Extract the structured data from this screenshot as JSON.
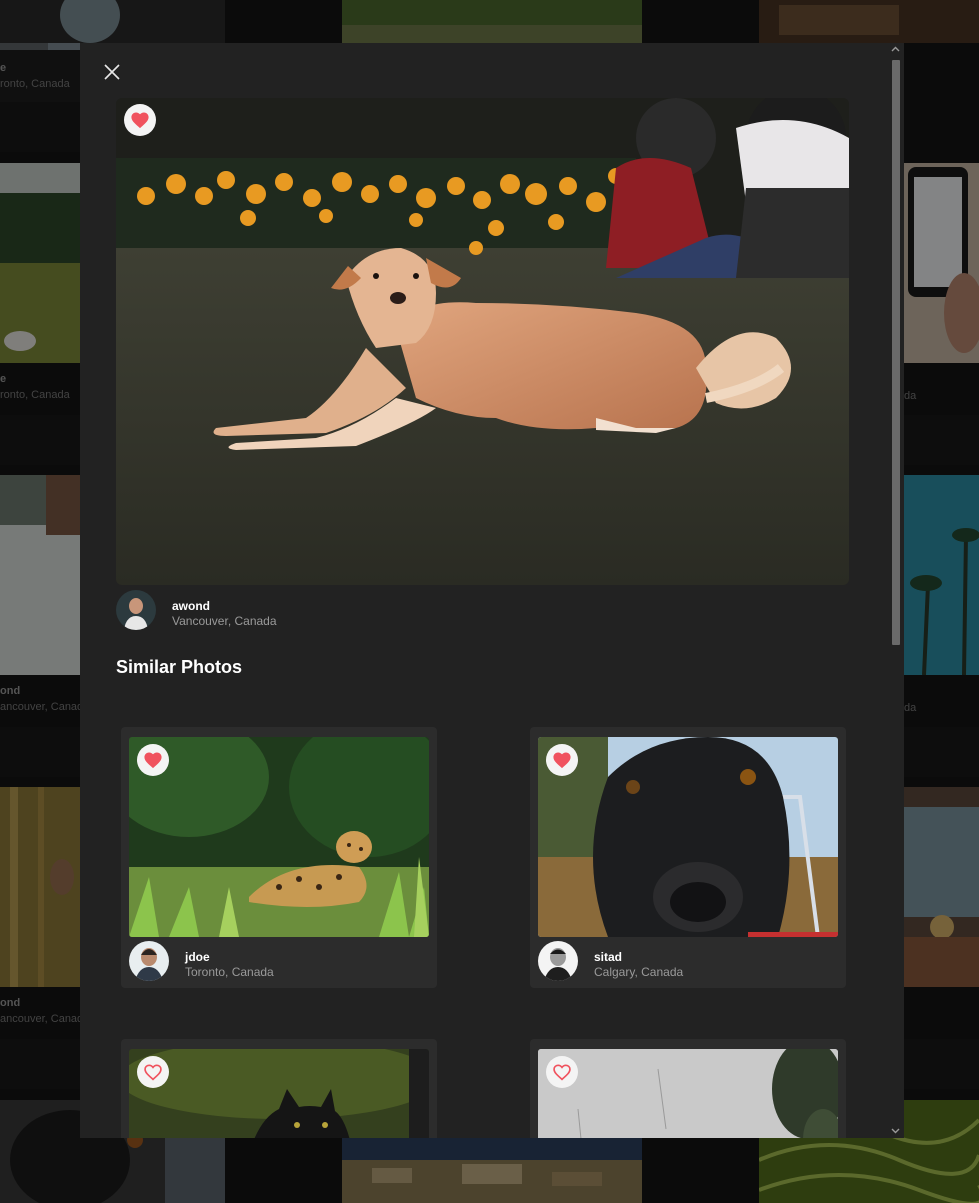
{
  "background_grid": {
    "cards": [
      {
        "name": "e",
        "location": "ronto, Canada"
      },
      {
        "name": "e",
        "location": "ronto, Canada"
      },
      {
        "name": "ond",
        "location": "ancouver, Canada"
      },
      {
        "name": "ond",
        "location": "ancouver, Canada"
      },
      {
        "name": "",
        "location": "da"
      },
      {
        "name": "",
        "location": "da"
      }
    ]
  },
  "modal": {
    "close_icon": "close-icon",
    "main_photo": {
      "liked": true,
      "author": {
        "name": "awond",
        "location": "Vancouver, Canada"
      }
    },
    "similar_title": "Similar Photos",
    "similar": [
      {
        "liked": true,
        "author": {
          "name": "jdoe",
          "location": "Toronto, Canada"
        }
      },
      {
        "liked": true,
        "author": {
          "name": "sitad",
          "location": "Calgary, Canada"
        }
      },
      {
        "liked": false,
        "author": {
          "name": "",
          "location": ""
        }
      },
      {
        "liked": false,
        "author": {
          "name": "",
          "location": ""
        }
      }
    ]
  },
  "colors": {
    "heart_red": "#f0525e",
    "modal_bg": "#222222",
    "card_bg": "#2c2c2c"
  }
}
